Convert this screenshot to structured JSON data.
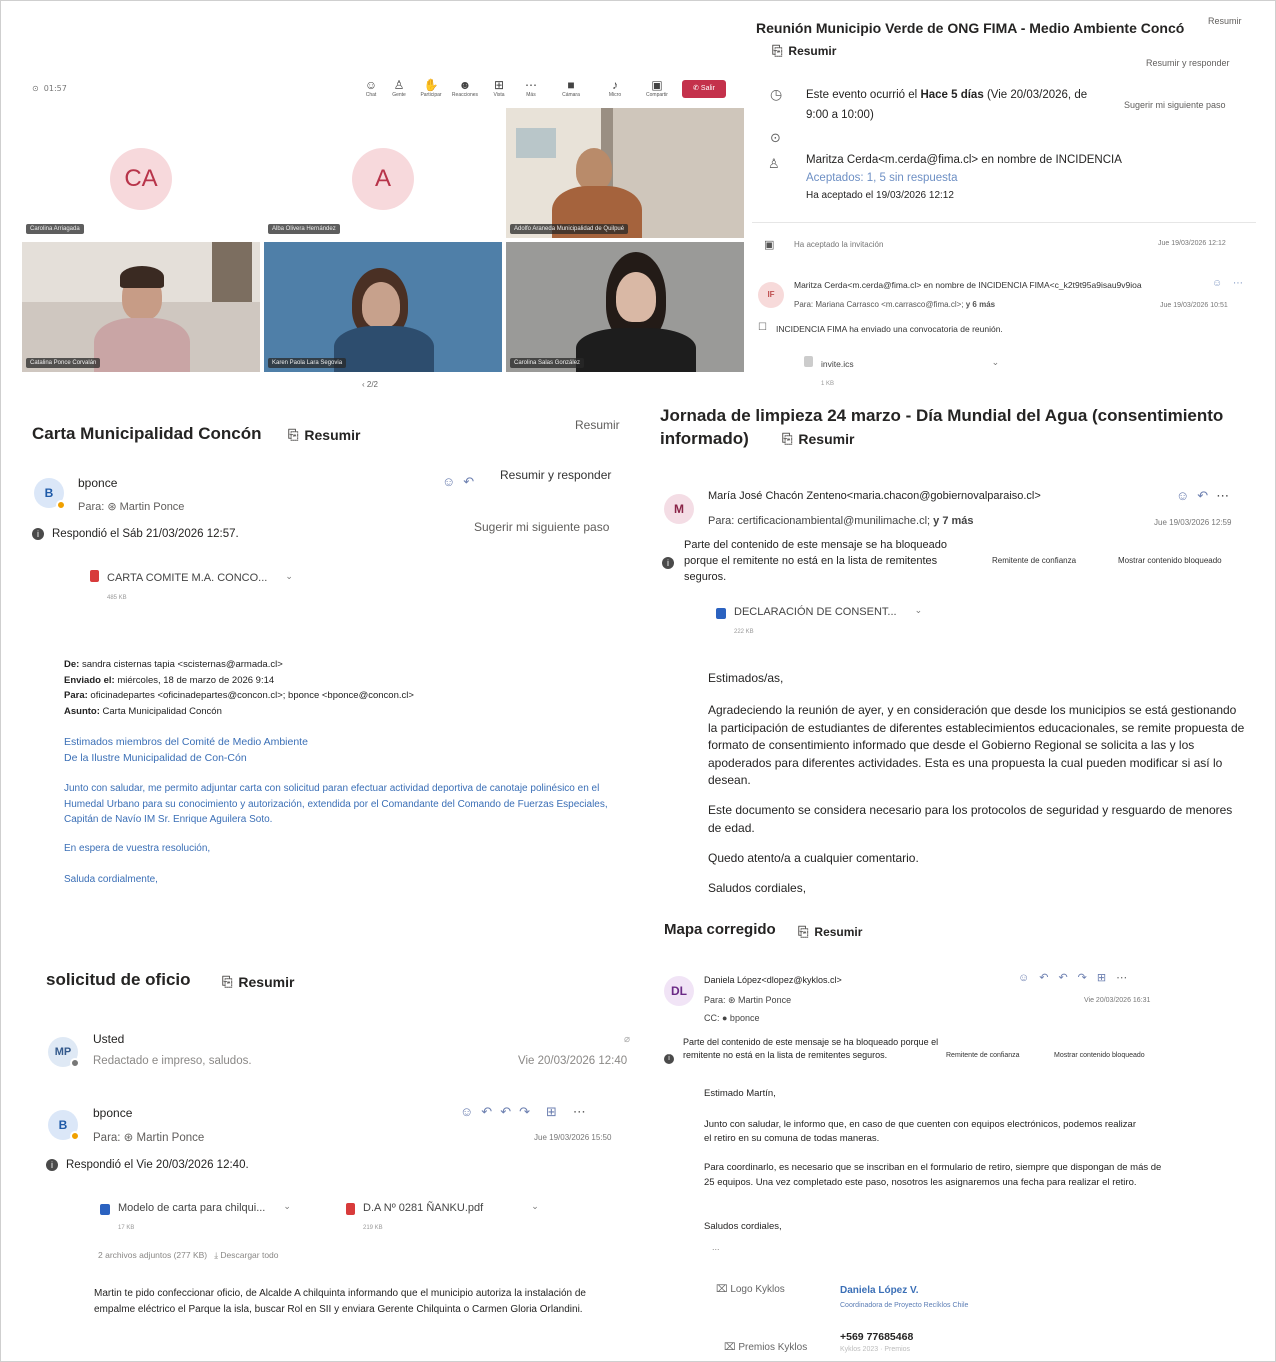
{
  "meeting": {
    "clock": "01:57",
    "toolbar": [
      {
        "icon": "chat-icon",
        "glyph": "☺",
        "label": "Chat"
      },
      {
        "icon": "people-icon",
        "glyph": "👥",
        "label": "Gente"
      },
      {
        "icon": "raise-hand-icon",
        "glyph": "✋",
        "label": "Participar"
      },
      {
        "icon": "reactions-icon",
        "glyph": "☺",
        "label": "Reacciones"
      },
      {
        "icon": "view-icon",
        "glyph": "⊞",
        "label": "Vista"
      },
      {
        "icon": "more-icon",
        "glyph": "⋯",
        "label": "Más"
      },
      {
        "icon": "camera-icon",
        "glyph": "■",
        "label": "Cámara"
      },
      {
        "icon": "mic-icon",
        "glyph": "🎤",
        "label": "Micro"
      },
      {
        "icon": "share-icon",
        "glyph": "▲",
        "label": "Compartir"
      }
    ],
    "leave_label": "Salir",
    "tiles": [
      {
        "initials": "CA",
        "name": "Carolina Arriagada"
      },
      {
        "initials": "A",
        "name": "Alba Olivera Hernández"
      },
      {
        "initials": "",
        "name": "Adolfo Araneda Municipalidad de Quilpué"
      },
      {
        "initials": "",
        "name": "Catalina Ponce Corvalán"
      },
      {
        "initials": "",
        "name": "Karen Paola Lara Segovia"
      },
      {
        "initials": "",
        "name": "Carolina Salas González"
      }
    ],
    "pager": "‹ 2/2"
  },
  "event": {
    "title": "Reunión Municipio Verde de ONG FIMA - Medio Ambiente Concó",
    "summarize": "Resumir",
    "summarize_top": "Resumir",
    "reply_summary": "Resumir y responder",
    "suggest": "Sugerir mi siguiente paso",
    "occurred_prefix": "Este evento ocurrió el",
    "occurred_bold": "Hace 5 días",
    "occurred_rest": "(Vie 20/03/2026, de",
    "time": "9:00 a 10:00)",
    "organizer": "Maritza Cerda<m.cerda@fima.cl> en nombre de INCIDENCIA",
    "accepted": "Aceptados: 1, 5 sin respuesta",
    "accepted_on": "Ha aceptado el 19/03/2026 12:12",
    "accepted_invite": "Ha aceptado la invitación",
    "accepted_invite_date": "Jue 19/03/2026 12:12",
    "sender_avatar": "IF",
    "sender": "Maritza Cerda<m.cerda@fima.cl> en nombre de INCIDENCIA FIMA<c_k2t9t95a9isau9v9ioa",
    "to": "Para: Mariana Carrasco <m.carrasco@fima.cl>;",
    "to_more": "y 6 más",
    "date": "Jue 19/03/2026 10:51",
    "invite_note": "INCIDENCIA FIMA ha enviado una convocatoria de reunión.",
    "file": "invite.ics",
    "file_size": "1 KB"
  },
  "carta": {
    "title": "Carta Municipalidad Concón",
    "summarize": "Resumir",
    "summarize_top": "Resumir",
    "reply_summary": "Resumir y responder",
    "suggest": "Sugerir mi siguiente paso",
    "avatar": "B",
    "sender": "bponce",
    "to": "Para: ⊛ Martin Ponce",
    "replied": "Respondió el Sáb 21/03/2026 12:57.",
    "file": "CARTA COMITE M.A. CONCO...",
    "file_size": "485 KB",
    "de_label": "De:",
    "de": "sandra cisternas tapia <scisternas@armada.cl>",
    "enviado_label": "Enviado el:",
    "enviado": "miércoles, 18 de marzo de 2026 9:14",
    "para_label": "Para:",
    "para": "oficinadepartes <oficinadepartes@concon.cl>; bponce <bponce@concon.cl>",
    "asunto_label": "Asunto:",
    "asunto": "Carta Municipalidad Concón",
    "greet1": "Estimados miembros del Comité de Medio Ambiente",
    "greet2": "De la Ilustre Municipalidad de Con-Cón",
    "body": "Junto con saludar, me permito adjuntar carta con solicitud paran efectuar actividad deportiva de canotaje polinésico en el Humedal Urbano para su conocimiento y autorización, extendida por el Comandante del Comando de Fuerzas Especiales, Capitán de Navío IM Sr. Enrique Aguilera Soto.",
    "wait": "En espera de vuestra resolución,",
    "closing": "Saluda cordialmente,"
  },
  "jornada": {
    "title": "Jornada de limpieza 24 marzo - Día Mundial del Agua (consentimiento",
    "title2": "informado)",
    "summarize": "Resumir",
    "avatar": "M",
    "sender": "María José Chacón Zenteno<maria.chacon@gobiernovalparaiso.cl>",
    "to": "Para: certificacionambiental@munilimache.cl;",
    "to_more": "y 7 más",
    "date": "Jue 19/03/2026 12:59",
    "blocked": "Parte del contenido de este mensaje se ha bloqueado porque el remitente no está en la lista de remitentes seguros.",
    "trusted": "Remitente de confianza",
    "show_blocked": "Mostrar contenido bloqueado",
    "file": "DECLARACIÓN DE CONSENT...",
    "file_size": "222 KB",
    "greeting": "Estimados/as,",
    "p1": "Agradeciendo la reunión de ayer, y en consideración que desde los municipios se está gestionando la participación de estudiantes de diferentes establecimientos educacionales, se remite propuesta de formato de consentimiento informado que desde el Gobierno Regional se solicita a las y los apoderados para diferentes actividades. Esta es una propuesta la cual pueden modificar si así lo desean.",
    "p2": "Este documento se considera necesario para los protocolos de seguridad y resguardo de menores de edad.",
    "p3": "Quedo atento/a a cualquier comentario.",
    "p4": "Saludos cordiales,"
  },
  "mapa": {
    "title": "Mapa corregido",
    "summarize": "Resumir",
    "avatar": "DL",
    "sender": "Daniela López<dlopez@kyklos.cl>",
    "to": "Para: ⊛ Martin Ponce",
    "cc": "CC: ● bponce",
    "date": "Vie 20/03/2026 16:31",
    "blocked": "Parte del contenido de este mensaje se ha bloqueado porque el remitente no está en la lista de remitentes seguros.",
    "trusted": "Remitente de confianza",
    "show_blocked": "Mostrar contenido bloqueado",
    "greeting": "Estimado Martín,",
    "p1": "Junto con saludar, le informo que, en caso de que cuenten con equipos electrónicos, podemos realizar el retiro en su comuna de todas maneras.",
    "p2": "Para coordinarlo, es necesario que se inscriban en el formulario de retiro, siempre que dispongan de más de 25 equipos. Una vez completado este paso, nosotros les asignaremos una fecha para realizar el retiro.",
    "p3": "Saludos cordiales,",
    "ellipsis": "...",
    "logo_alt": "Logo Kyklos",
    "sig_name": "Daniela López V.",
    "sig_role": "Coordinadora de Proyecto Recíklos Chile",
    "phone": "+569 77685468",
    "awards_alt": "Premios Kyklos",
    "web": "Kyklos 2023 · Premios"
  },
  "oficio": {
    "title": "solicitud de oficio",
    "summarize": "Resumir",
    "draft_avatar": "MP",
    "draft_sender": "Usted",
    "draft_preview": "Redactado e impreso, saludos.",
    "draft_date": "Vie 20/03/2026 12:40",
    "avatar": "B",
    "sender": "bponce",
    "to": "Para: ⊛ Martin Ponce",
    "date": "Jue 19/03/2026 15:50",
    "replied": "Respondió el Vie 20/03/2026 12:40.",
    "file1": "Modelo de carta para chilqui...",
    "file1_size": "17 KB",
    "file2": "D.A Nº 0281 ÑANKU.pdf",
    "file2_size": "219 KB",
    "attach_summary": "2 archivos adjuntos (277 KB)",
    "download_all": "Descargar todo",
    "body": "Martin te pido confeccionar oficio, de Alcalde A chilquinta informando que el municipio autoriza la instalación de empalme eléctrico el Parque la isla, buscar Rol en SII y enviara Gerente Chilquinta o Carmen Gloria Orlandini."
  }
}
